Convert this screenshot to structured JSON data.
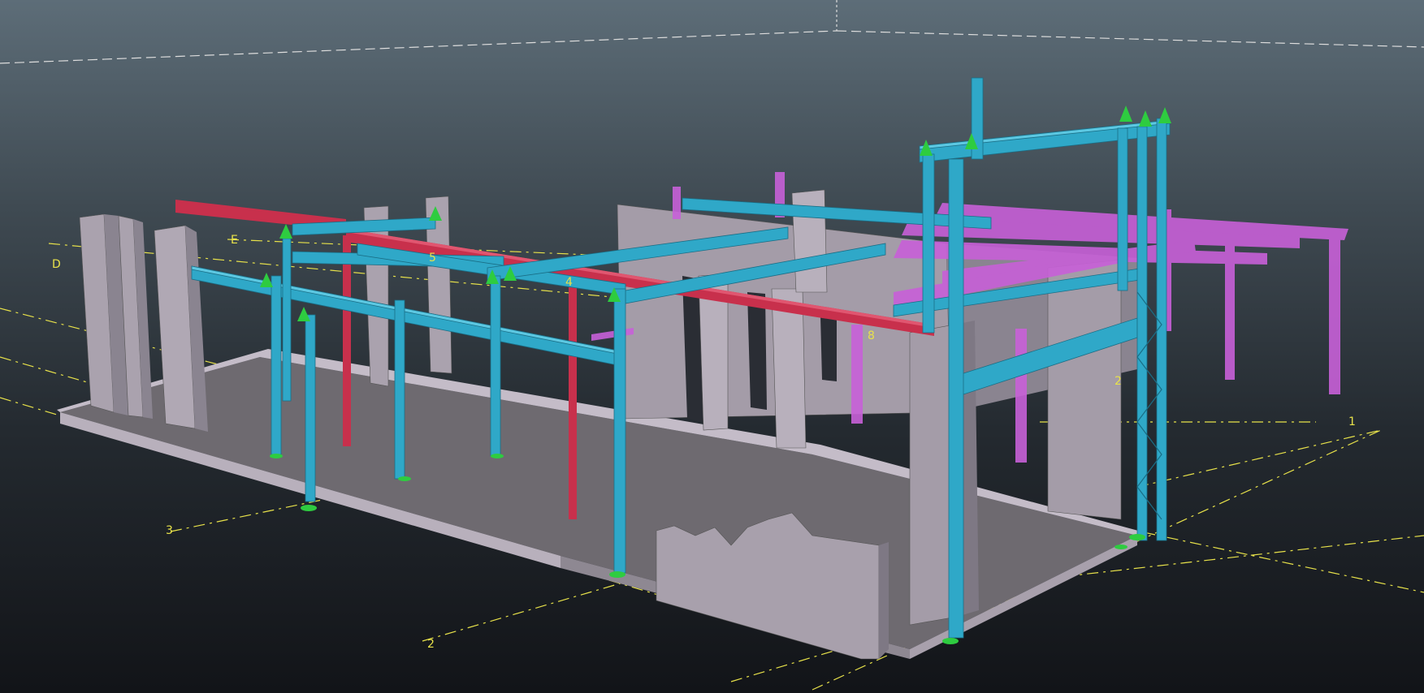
{
  "viewport": {
    "grid_labels": {
      "axis_d": "D",
      "axis_e": "E",
      "axis_1": "1",
      "axis_2_front": "2",
      "axis_2_right": "2",
      "axis_3": "3",
      "axis_4": "4",
      "axis_5": "5",
      "axis_8": "8"
    }
  },
  "colors": {
    "background_top": "#5d6d78",
    "background_bottom": "#121418",
    "grid_line": "#e8e24a",
    "concrete": "#9a929e",
    "steel_member": "#2fa8c8",
    "selected_red": "#c8304c",
    "magenta_reference": "#c860d8",
    "support_marker": "#2ecc40"
  }
}
